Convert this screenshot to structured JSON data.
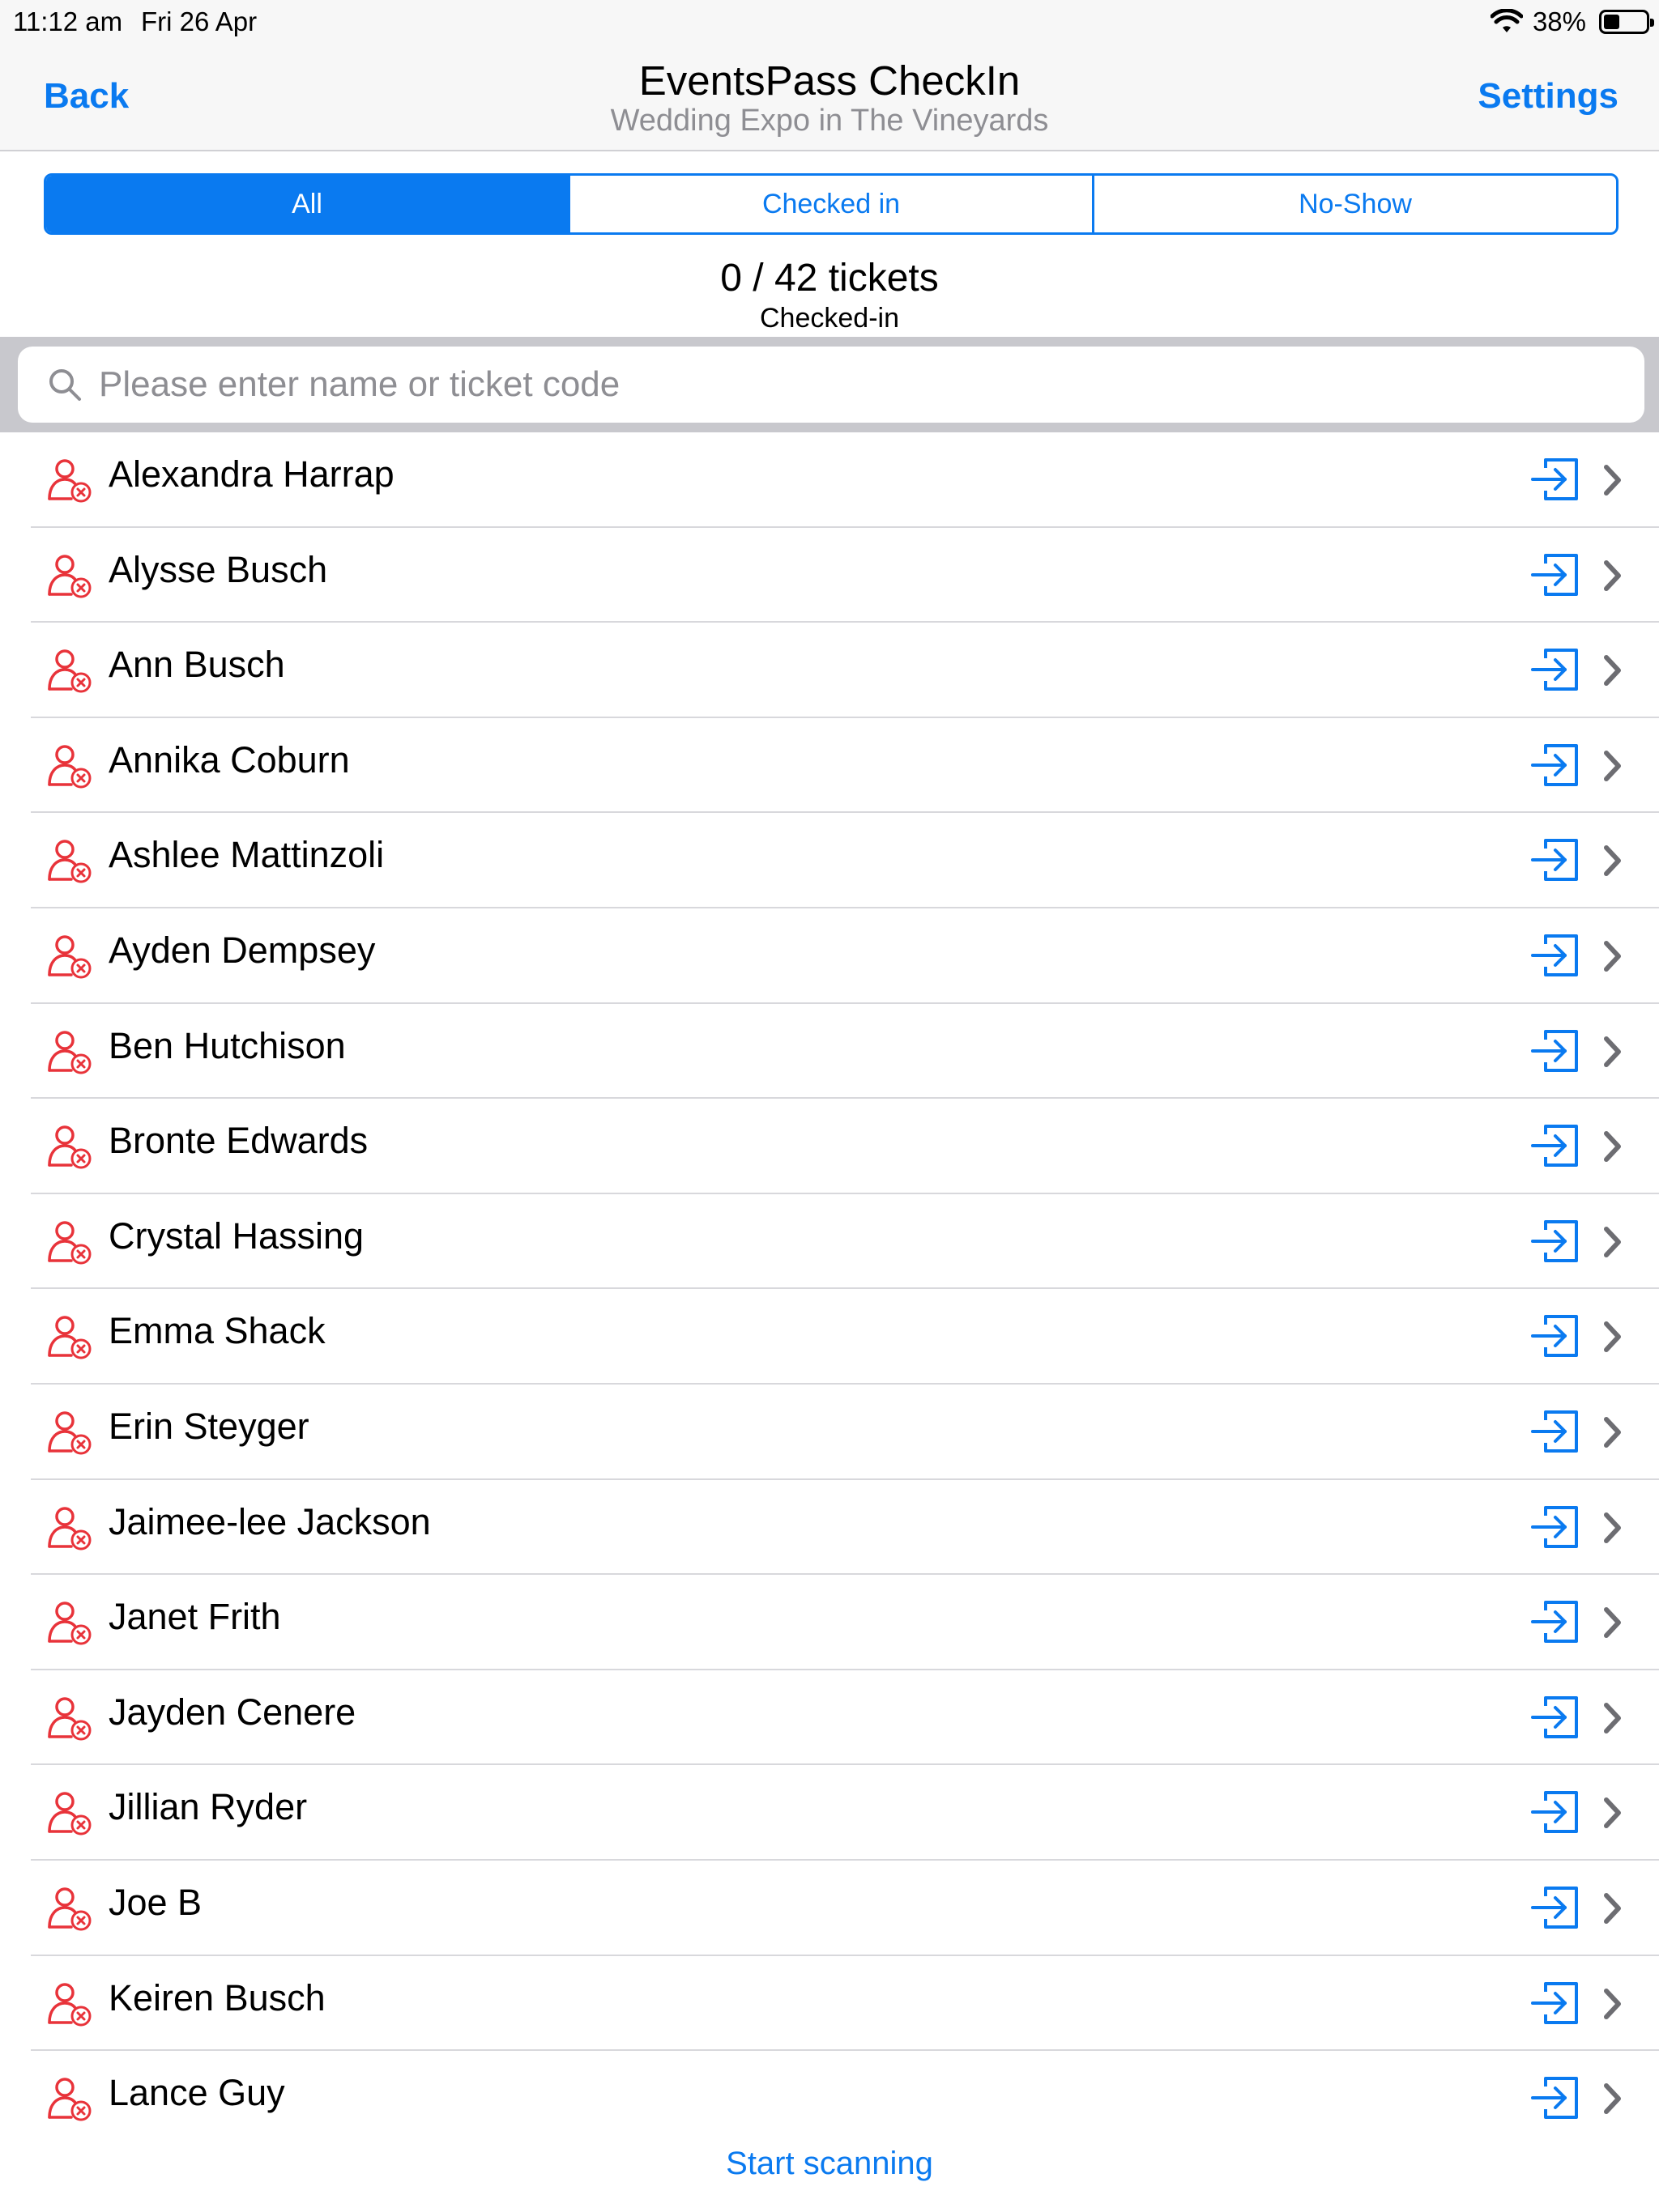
{
  "status_bar": {
    "time": "11:12 am",
    "date": "Fri 26 Apr",
    "battery": "38%",
    "battery_level": 0.38
  },
  "nav": {
    "back_label": "Back",
    "title": "EventsPass CheckIn",
    "subtitle": "Wedding Expo in The Vineyards",
    "settings_label": "Settings"
  },
  "tabs": [
    {
      "label": "All",
      "selected": true
    },
    {
      "label": "Checked in",
      "selected": false
    },
    {
      "label": "No-Show",
      "selected": false
    }
  ],
  "summary": {
    "count": "0 / 42 tickets",
    "label": "Checked-in"
  },
  "search": {
    "placeholder": "Please enter name or ticket code",
    "value": ""
  },
  "attendees": [
    "Alexandra Harrap",
    "Alysse Busch",
    "Ann Busch",
    "Annika Coburn",
    "Ashlee Mattinzoli",
    "Ayden Dempsey",
    "Ben Hutchison",
    "Bronte Edwards",
    "Crystal Hassing",
    "Emma Shack",
    "Erin Steyger",
    "Jaimee-lee Jackson",
    "Janet Frith",
    "Jayden Cenere",
    "Jillian Ryder",
    "Joe B",
    "Keiren Busch",
    "Lance Guy"
  ],
  "footer": {
    "start_scanning_label": "Start scanning"
  },
  "colors": {
    "accent": "#0a7af0",
    "not_checked_in": "#e8333a",
    "chevron": "#6d6d72"
  },
  "icons": {
    "row_status": "person-not-checked-in-icon",
    "row_action": "check-in-icon",
    "row_disclosure": "chevron-right-icon"
  }
}
